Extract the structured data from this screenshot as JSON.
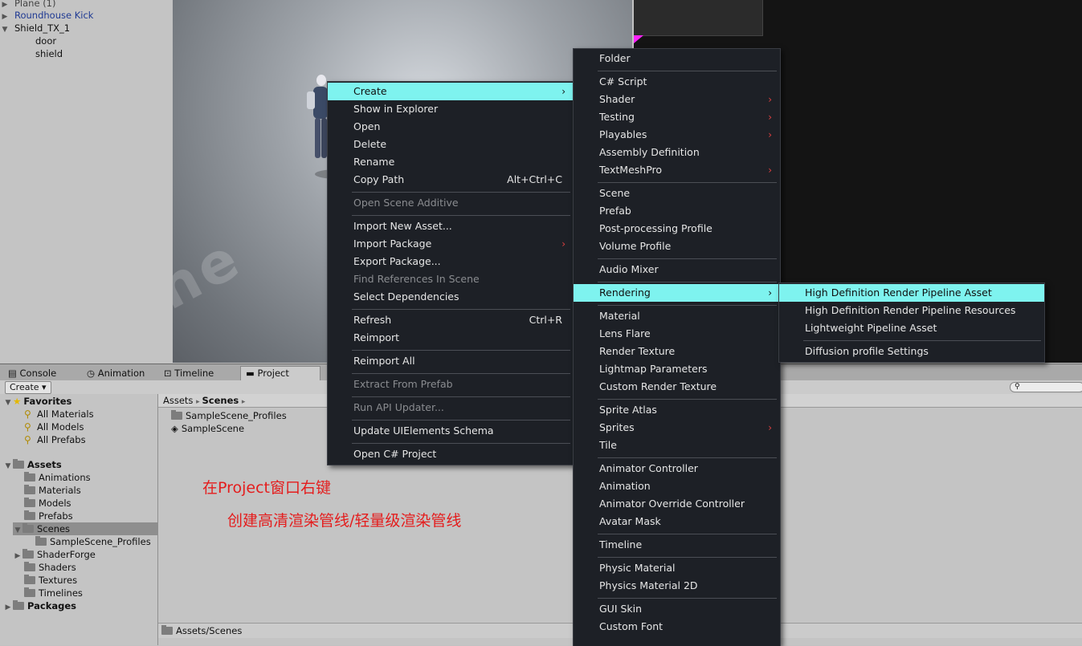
{
  "hierarchy": {
    "items": [
      "Plane (1)",
      "Roundhouse Kick",
      "Shield_TX_1",
      "door",
      "shield"
    ]
  },
  "scene": {
    "floor_text": "ne"
  },
  "tabs": [
    "Console",
    "Animation",
    "Timeline",
    "Project"
  ],
  "project": {
    "create_label": "Create ▾",
    "search_placeholder": "",
    "favorites": {
      "label": "Favorites",
      "items": [
        "All Materials",
        "All Models",
        "All Prefabs"
      ]
    },
    "assets": {
      "label": "Assets",
      "items": [
        "Animations",
        "Materials",
        "Models",
        "Prefabs",
        "Scenes",
        "SampleScene_Profiles",
        "ShaderForge",
        "Shaders",
        "Textures",
        "Timelines"
      ]
    },
    "packages_label": "Packages",
    "breadcrumb": [
      "Assets",
      "Scenes"
    ],
    "files": [
      "SampleScene_Profiles",
      "SampleScene"
    ],
    "path": "Assets/Scenes"
  },
  "annotation": {
    "line1": "在Project窗口右键",
    "line2": "创建高清渲染管线/轻量级渲染管线"
  },
  "context_menu": [
    {
      "label": "Create",
      "submenu": true,
      "highlight": true
    },
    {
      "label": "Show in Explorer"
    },
    {
      "label": "Open"
    },
    {
      "label": "Delete"
    },
    {
      "label": "Rename"
    },
    {
      "label": "Copy Path",
      "shortcut": "Alt+Ctrl+C"
    },
    {
      "label": "Open Scene Additive",
      "disabled": true
    },
    {
      "label": "Import New Asset..."
    },
    {
      "label": "Import Package",
      "submenu": true
    },
    {
      "label": "Export Package..."
    },
    {
      "label": "Find References In Scene",
      "disabled": true
    },
    {
      "label": "Select Dependencies"
    },
    {
      "label": "Refresh",
      "shortcut": "Ctrl+R"
    },
    {
      "label": "Reimport"
    },
    {
      "label": "Reimport All"
    },
    {
      "label": "Extract From Prefab",
      "disabled": true
    },
    {
      "label": "Run API Updater...",
      "disabled": true
    },
    {
      "label": "Update UIElements Schema"
    },
    {
      "label": "Open C# Project"
    }
  ],
  "create_menu": [
    {
      "label": "Folder"
    },
    {
      "label": "C# Script"
    },
    {
      "label": "Shader",
      "submenu": true
    },
    {
      "label": "Testing",
      "submenu": true
    },
    {
      "label": "Playables",
      "submenu": true
    },
    {
      "label": "Assembly Definition"
    },
    {
      "label": "TextMeshPro",
      "submenu": true
    },
    {
      "label": "Scene"
    },
    {
      "label": "Prefab"
    },
    {
      "label": "Post-processing Profile"
    },
    {
      "label": "Volume Profile"
    },
    {
      "label": "Audio Mixer"
    },
    {
      "label": "Rendering",
      "submenu": true,
      "highlight": true
    },
    {
      "label": "Material"
    },
    {
      "label": "Lens Flare"
    },
    {
      "label": "Render Texture"
    },
    {
      "label": "Lightmap Parameters"
    },
    {
      "label": "Custom Render Texture"
    },
    {
      "label": "Sprite Atlas"
    },
    {
      "label": "Sprites",
      "submenu": true
    },
    {
      "label": "Tile"
    },
    {
      "label": "Animator Controller"
    },
    {
      "label": "Animation"
    },
    {
      "label": "Animator Override Controller"
    },
    {
      "label": "Avatar Mask"
    },
    {
      "label": "Timeline"
    },
    {
      "label": "Physic Material"
    },
    {
      "label": "Physics Material 2D"
    },
    {
      "label": "GUI Skin"
    },
    {
      "label": "Custom Font"
    }
  ],
  "rendering_menu": [
    {
      "label": "High Definition Render Pipeline Asset",
      "highlight": true
    },
    {
      "label": "High Definition Render Pipeline Resources"
    },
    {
      "label": "Lightweight Pipeline Asset"
    },
    {
      "label": "Diffusion profile Settings"
    }
  ]
}
